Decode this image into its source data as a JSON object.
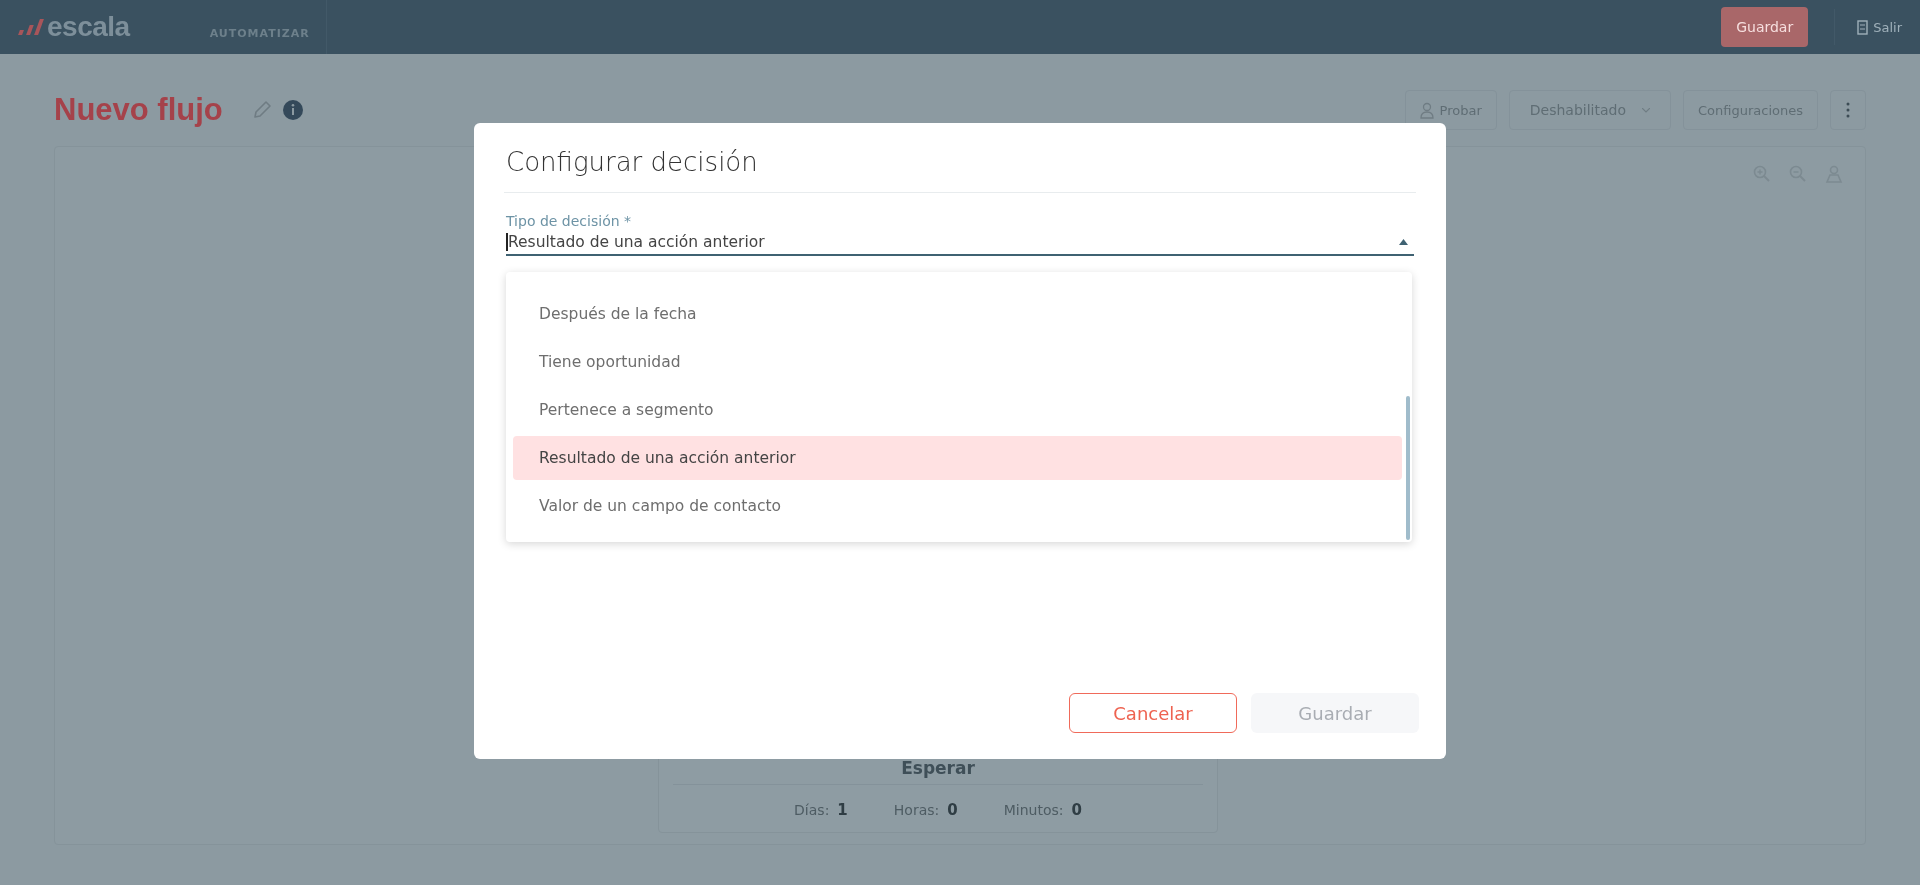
{
  "top_bar": {
    "logo": "escala",
    "section": "AUTOMATIZAR",
    "save_button": "Guardar",
    "exit": "Salir"
  },
  "page": {
    "title": "Nuevo flujo",
    "actions": [
      {
        "kind": "test",
        "label": "Probar"
      },
      {
        "kind": "dropdown",
        "label": "Deshabilitado"
      },
      {
        "kind": "plain",
        "label": "Configuraciones"
      },
      {
        "kind": "more"
      }
    ]
  },
  "canvas": {
    "node": {
      "title": "Esperar",
      "fields": [
        {
          "label": "Días:",
          "value": "1"
        },
        {
          "label": "Horas:",
          "value": "0"
        },
        {
          "label": "Minutos:",
          "value": "0"
        }
      ]
    }
  },
  "dialog": {
    "title": "Configurar decisión",
    "field": {
      "label": "Tipo de decisión *",
      "value": "Resultado de una acción anterior",
      "expanded": true
    },
    "options": [
      {
        "label": "Después de la fecha",
        "selected": false
      },
      {
        "label": "Tiene oportunidad",
        "selected": false
      },
      {
        "label": "Pertenece a segmento",
        "selected": false
      },
      {
        "label": "Resultado de una acción anterior",
        "selected": true
      },
      {
        "label": "Valor de un campo de contacto",
        "selected": false
      }
    ],
    "buttons": [
      {
        "kind": "secondary",
        "label": "Cancelar",
        "disabled": false
      },
      {
        "kind": "primary",
        "label": "Guardar",
        "disabled": true
      }
    ]
  }
}
